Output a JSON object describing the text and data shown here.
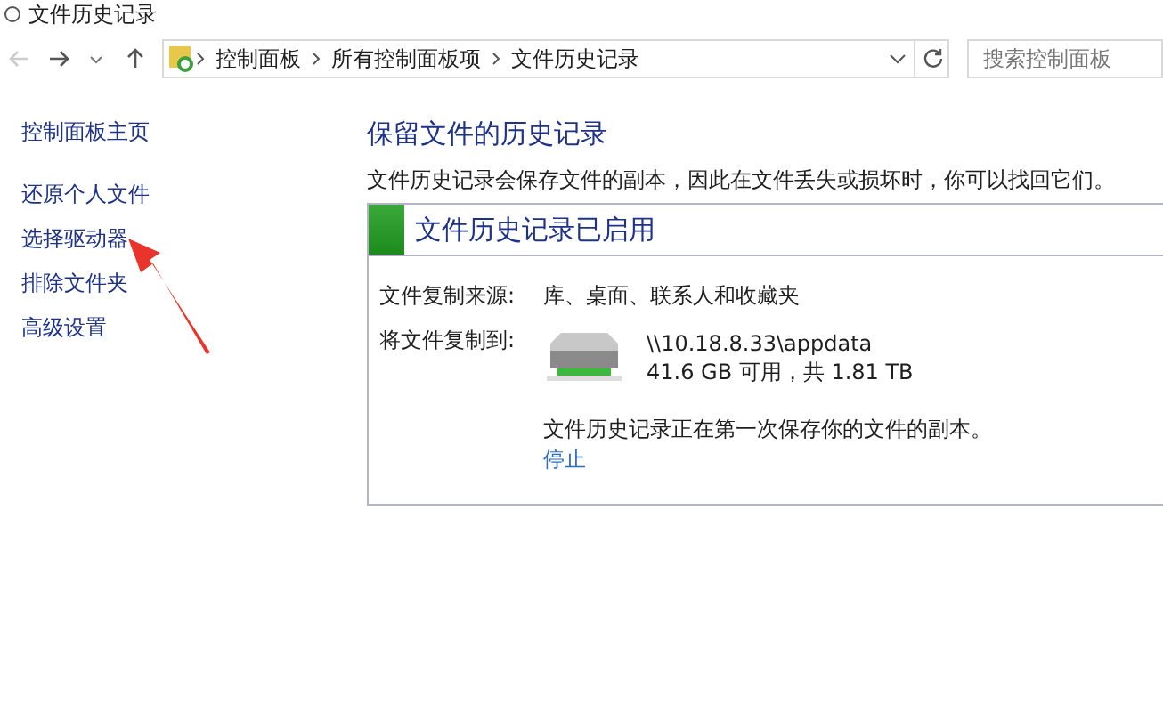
{
  "window": {
    "title": "文件历史记录"
  },
  "address_bar": {
    "breadcrumbs": [
      "控制面板",
      "所有控制面板项",
      "文件历史记录"
    ]
  },
  "search": {
    "placeholder": "搜索控制面板"
  },
  "sidebar": {
    "home": "控制面板主页",
    "items": [
      {
        "label": "还原个人文件"
      },
      {
        "label": "选择驱动器"
      },
      {
        "label": "排除文件夹"
      },
      {
        "label": "高级设置"
      }
    ]
  },
  "main": {
    "heading": "保留文件的历史记录",
    "description": "文件历史记录会保存文件的副本，因此在文件丢失或损坏时，你可以找回它们。",
    "status_panel": {
      "title": "文件历史记录已启用",
      "source_label": "文件复制来源:",
      "source_value": "库、桌面、联系人和收藏夹",
      "target_label": "将文件复制到:",
      "drive_path": "\\\\10.18.8.33\\appdata",
      "drive_space": "41.6 GB 可用，共 1.81 TB",
      "progress_message": "文件历史记录正在第一次保存你的文件的副本。",
      "stop_link": "停止"
    }
  }
}
